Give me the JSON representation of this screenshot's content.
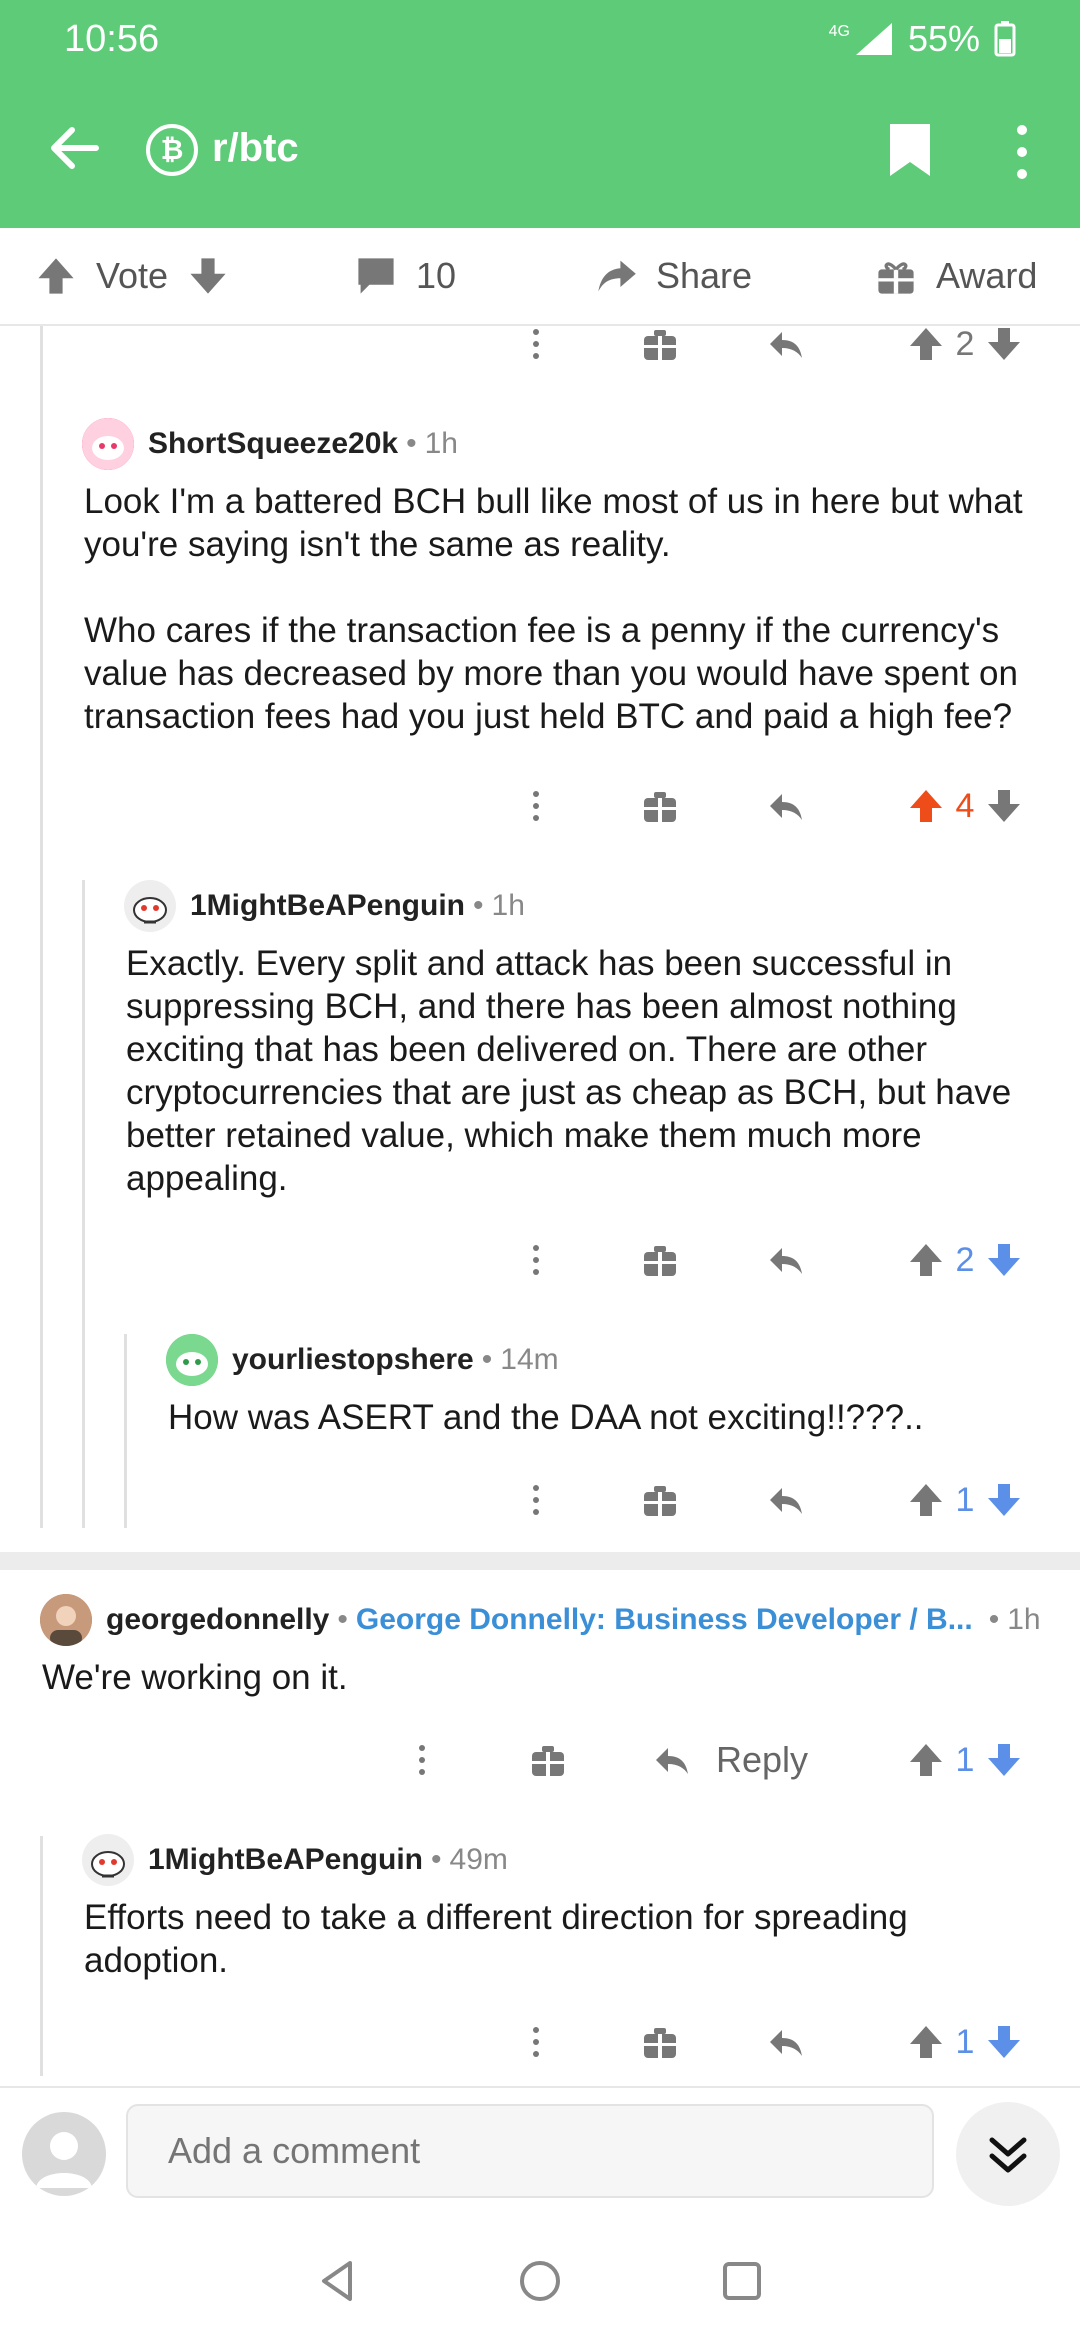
{
  "status": {
    "time": "10:56",
    "network": "4G",
    "battery": "55%"
  },
  "app_bar": {
    "subreddit": "r/btc",
    "sub_icon_glyph": "₿"
  },
  "action_bar": {
    "vote_label": "Vote",
    "comment_count": "10",
    "share_label": "Share",
    "award_label": "Award"
  },
  "top_row": {
    "score": "2"
  },
  "comments": [
    {
      "author": "ShortSqueeze20k",
      "time": "1h",
      "body": "Look I'm a battered BCH bull like most of us in here but what you're saying isn't the same as reality.\n\nWho cares if the transaction fee is a penny if the currency's value has decreased by more than you would have spent on transaction fees had you just held BTC and paid a high fee?",
      "score": "4",
      "vote_state": "up"
    },
    {
      "author": "1MightBeAPenguin",
      "time": "1h",
      "body": "Exactly. Every split and attack has been successful in suppressing BCH, and there has been almost nothing exciting that has been delivered on. There are other cryptocurrencies that are just as cheap as BCH, but have better retained value, which make them much more appealing.",
      "score": "2",
      "vote_state": "down"
    },
    {
      "author": "yourliestopshere",
      "time": "14m",
      "body": "How was ASERT and the DAA not exciting!!???..",
      "score": "1",
      "vote_state": "down"
    },
    {
      "author": "georgedonnelly",
      "flair": "George Donnelly: Business Developer / B...",
      "time": "1h",
      "body": "We're working on it.",
      "reply_label": "Reply",
      "score": "1",
      "vote_state": "down"
    },
    {
      "author": "1MightBeAPenguin",
      "time": "49m",
      "body": "Efforts need to take a different direction for spreading adoption.",
      "score": "1",
      "vote_state": "down"
    }
  ],
  "composer": {
    "placeholder": "Add a comment"
  },
  "colors": {
    "brand_green": "#5ecb79",
    "upvote_orange": "#ee4d1a",
    "downvote_blue": "#5c8fe8",
    "flair_blue": "#3a8fd6"
  },
  "icons": [
    "back-arrow-icon",
    "bitcoin-icon",
    "bookmark-icon",
    "more-vertical-icon",
    "upvote-icon",
    "downvote-icon",
    "comment-icon",
    "share-icon",
    "gift-icon",
    "reply-icon",
    "chevron-double-down-icon",
    "nav-back-icon",
    "nav-home-icon",
    "nav-recents-icon"
  ]
}
